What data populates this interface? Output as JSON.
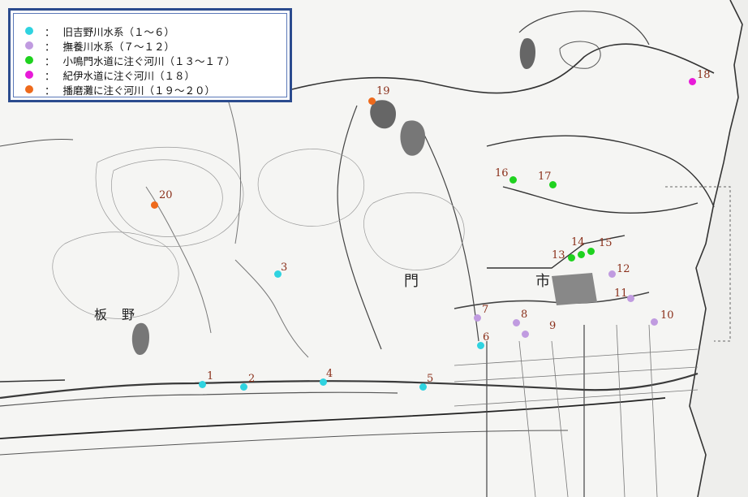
{
  "legend": {
    "items": [
      {
        "symbol": "：",
        "text": "旧吉野川水系（１～６）",
        "color": "#2fd3e0"
      },
      {
        "symbol": "：",
        "text": "撫養川水系（７～１２）",
        "color": "#c09be0"
      },
      {
        "symbol": "：",
        "text": "小鳴門水道に注ぐ河川（１３～１７）",
        "color": "#1fd21f"
      },
      {
        "symbol": "：",
        "text": "紀伊水道に注ぐ河川（１８）",
        "color": "#e81ad8"
      },
      {
        "symbol": "：",
        "text": "播磨灘に注ぐ河川（１９～２０）",
        "color": "#ee6a1c"
      }
    ]
  },
  "map": {
    "place_labels": [
      "市",
      "門",
      "板",
      "野"
    ],
    "sites": [
      {
        "label": "1",
        "group": 0
      },
      {
        "label": "2",
        "group": 0
      },
      {
        "label": "3",
        "group": 0
      },
      {
        "label": "4",
        "group": 0
      },
      {
        "label": "5",
        "group": 0
      },
      {
        "label": "6",
        "group": 0
      },
      {
        "label": "7",
        "group": 1
      },
      {
        "label": "8",
        "group": 1
      },
      {
        "label": "9",
        "group": 1
      },
      {
        "label": "10",
        "group": 1
      },
      {
        "label": "11",
        "group": 1
      },
      {
        "label": "12",
        "group": 1
      },
      {
        "label": "13",
        "group": 2
      },
      {
        "label": "14",
        "group": 2
      },
      {
        "label": "15",
        "group": 2
      },
      {
        "label": "16",
        "group": 2
      },
      {
        "label": "17",
        "group": 2
      },
      {
        "label": "18",
        "group": 3
      },
      {
        "label": "19",
        "group": 4
      },
      {
        "label": "20",
        "group": 4
      }
    ]
  }
}
